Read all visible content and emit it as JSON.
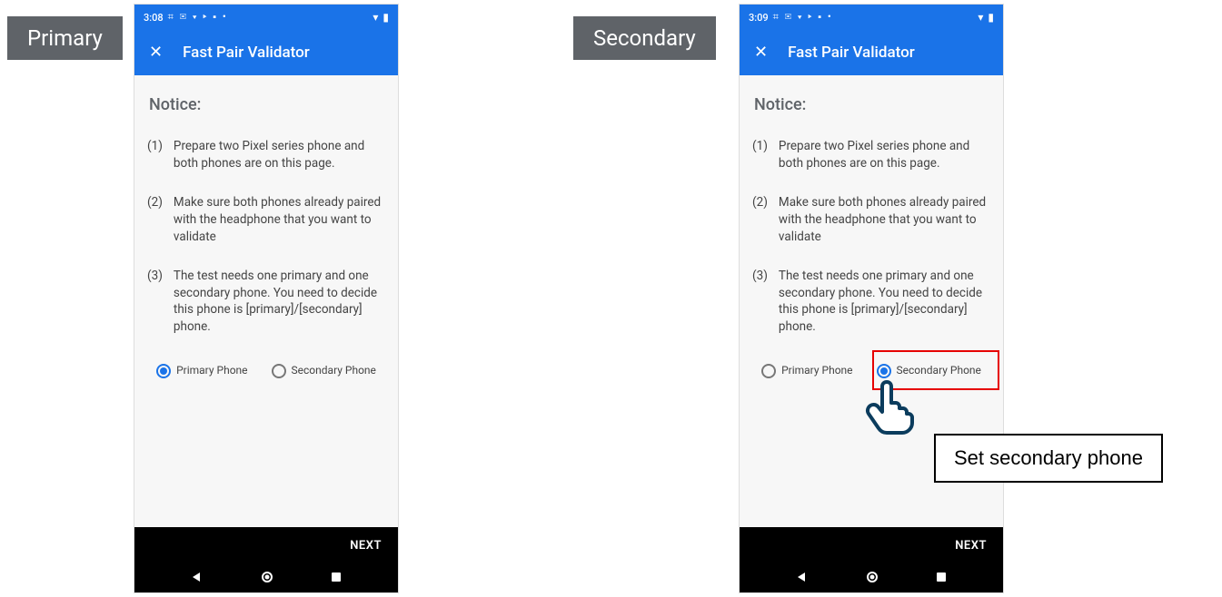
{
  "labels": {
    "primary": "Primary",
    "secondary": "Secondary"
  },
  "callout": "Set secondary phone",
  "left_phone": {
    "status_time": "3:08",
    "app_title": "Fast Pair Validator",
    "notice_heading": "Notice:",
    "steps": [
      {
        "num": "(1)",
        "text": "Prepare two Pixel series phone and both phones are on this page."
      },
      {
        "num": "(2)",
        "text": "Make sure both phones already paired with the headphone that you want to validate"
      },
      {
        "num": "(3)",
        "text": "The test needs one primary and one secondary phone. You need to decide this phone is [primary]/[secondary] phone."
      }
    ],
    "radio_primary": "Primary Phone",
    "radio_secondary": "Secondary Phone",
    "next_label": "NEXT"
  },
  "right_phone": {
    "status_time": "3:09",
    "app_title": "Fast Pair Validator",
    "notice_heading": "Notice:",
    "steps": [
      {
        "num": "(1)",
        "text": "Prepare two Pixel series phone and both phones are on this page."
      },
      {
        "num": "(2)",
        "text": "Make sure both phones already paired with the headphone that you want to validate"
      },
      {
        "num": "(3)",
        "text": "The test needs one primary and one secondary phone. You need to decide this phone is [primary]/[secondary] phone."
      }
    ],
    "radio_primary": "Primary Phone",
    "radio_secondary": "Secondary Phone",
    "next_label": "NEXT"
  }
}
